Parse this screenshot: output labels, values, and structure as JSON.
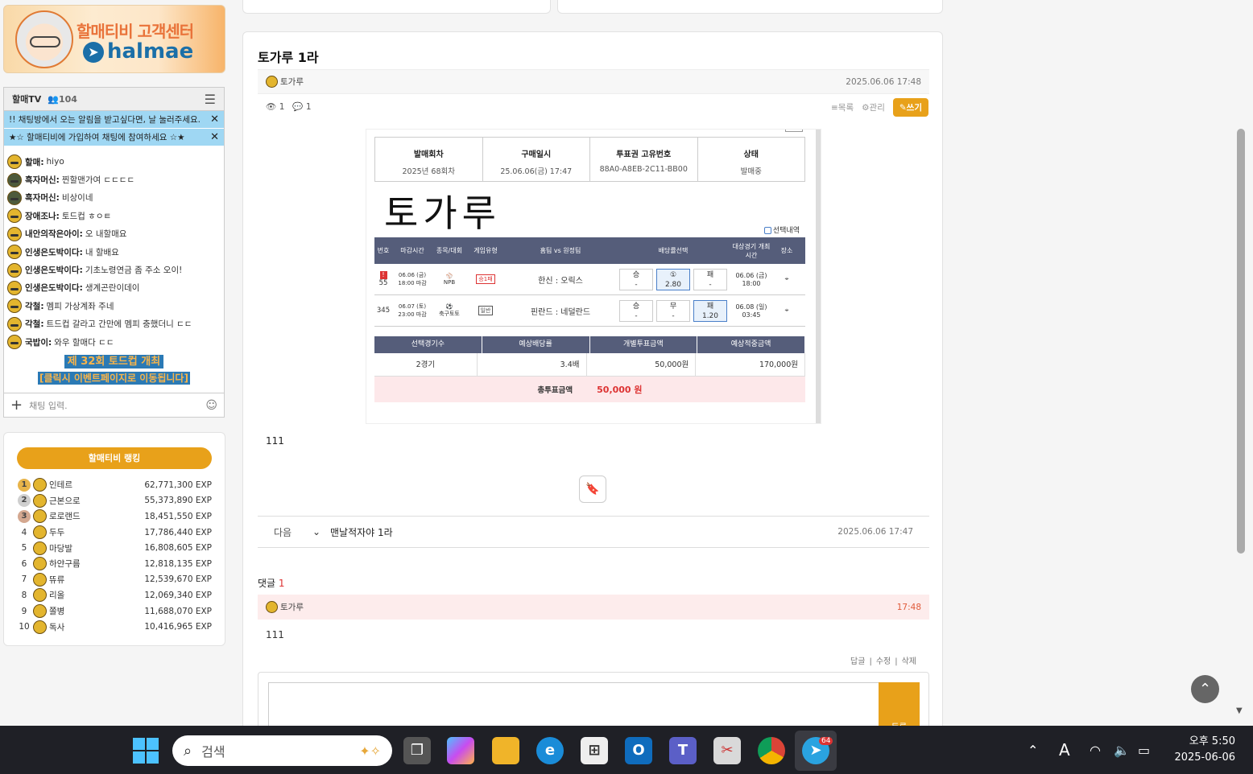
{
  "banner": {
    "title": "할매티비 고객센터",
    "brand": "halmae"
  },
  "chat": {
    "title": "할매TV",
    "count": "104",
    "notices": [
      "!! 채팅방에서 오는 알림을 받고싶다면, 날 눌러주세요.",
      "★☆ 할매티비에 가입하여 채팅에 참여하세요 ☆★"
    ],
    "messages": [
      {
        "nick": "할매:",
        "text": "hiyo"
      },
      {
        "nick": "흑자머신:",
        "text": "찐할맨가여 ㄷㄷㄷㄷ"
      },
      {
        "nick": "흑자머신:",
        "text": "비상이네"
      },
      {
        "nick": "장애조나:",
        "text": "토드컵 ㅎㅇㅌ"
      },
      {
        "nick": "내안의작은아이:",
        "text": "오 내할매요"
      },
      {
        "nick": "인생은도박이다:",
        "text": "내 할배요"
      },
      {
        "nick": "인생은도박이다:",
        "text": "기초노령연금 좀 주소 오이!"
      },
      {
        "nick": "인생은도박이다:",
        "text": "생계곤란이데이"
      },
      {
        "nick": "각철:",
        "text": "멤피 가상계좌 주네"
      },
      {
        "nick": "각철:",
        "text": "트드컵 갈라고 간만에 멤피 충했더니 ㄷㄷ"
      },
      {
        "nick": "국밥이:",
        "text": "와우 할매다 ㄷㄷ"
      }
    ],
    "event_line1": "제 32회 토드컵 개최",
    "event_line2": "[클릭시 이벤트페이지로 이동됩니다]",
    "input_placeholder": "채팅 입력."
  },
  "ranking": {
    "title": "할매티비 랭킹",
    "rows": [
      {
        "rank": "1",
        "name": "인테르",
        "exp": "62,771,300 EXP"
      },
      {
        "rank": "2",
        "name": "근본으로",
        "exp": "55,373,890 EXP"
      },
      {
        "rank": "3",
        "name": "로로랜드",
        "exp": "18,451,550 EXP"
      },
      {
        "rank": "4",
        "name": "두두",
        "exp": "17,786,440 EXP"
      },
      {
        "rank": "5",
        "name": "마당발",
        "exp": "16,808,605 EXP"
      },
      {
        "rank": "6",
        "name": "하얀구름",
        "exp": "12,818,135 EXP"
      },
      {
        "rank": "7",
        "name": "뜌류",
        "exp": "12,539,670 EXP"
      },
      {
        "rank": "8",
        "name": "리올",
        "exp": "12,069,340 EXP"
      },
      {
        "rank": "9",
        "name": "쫄병",
        "exp": "11,688,070 EXP"
      },
      {
        "rank": "10",
        "name": "독사",
        "exp": "10,416,965 EXP"
      }
    ]
  },
  "article": {
    "title": "토가루 1라",
    "author": "토가루",
    "date": "2025.06.06 17:48",
    "views": "1",
    "comments": "1",
    "list_label": "목록",
    "manage_label": "관리",
    "write_label": "쓰기",
    "body": "111"
  },
  "ticket": {
    "head": [
      {
        "k": "발매회차",
        "v": "2025년 68회차"
      },
      {
        "k": "구매일시",
        "v": "25.06.06(금) 17:47"
      },
      {
        "k": "투표권 고유번호",
        "v": "88A0-A8EB-2C11-BB00"
      },
      {
        "k": "상태",
        "v": "발매중"
      }
    ],
    "handwriting": "토가루",
    "select_history": "선택내역",
    "columns": [
      "번호",
      "마감시간",
      "종목/대회",
      "게임유형",
      "홈팀 vs 원정팀",
      "배당률선택",
      "대상경기 개최시간",
      "장소"
    ],
    "rows": [
      {
        "no": "55",
        "deadline": "06.06 (금) 18:00 마감",
        "sport": "NPB",
        "type": "승1패",
        "match": "한신 : 오릭스",
        "odds": [
          {
            "l": "승",
            "v": "-"
          },
          {
            "l": "①",
            "v": "2.80"
          },
          {
            "l": "패",
            "v": "-"
          }
        ],
        "game_time": "06.06 (금) 18:00"
      },
      {
        "no": "345",
        "deadline": "06.07 (토) 23:00 마감",
        "sport": "축구토토",
        "type": "일반",
        "match": "핀란드 : 네덜란드",
        "odds": [
          {
            "l": "승",
            "v": "-"
          },
          {
            "l": "무",
            "v": "-"
          },
          {
            "l": "패",
            "v": "1.20"
          }
        ],
        "game_time": "06.08 (일) 03:45"
      }
    ],
    "summary_head": [
      "선택경기수",
      "예상배당률",
      "개별투표금액",
      "예상적중금액"
    ],
    "summary_vals": [
      "2경기",
      "3.4배",
      "50,000원",
      "170,000원"
    ],
    "total_label": "총투표금액",
    "total_value": "50,000 원"
  },
  "nav": {
    "label": "다음",
    "title": "맨날적자야 1라",
    "date": "2025.06.06 17:47"
  },
  "comments": {
    "label": "댓글",
    "count": "1",
    "items": [
      {
        "author": "토가루",
        "time": "17:48",
        "text": "111"
      }
    ],
    "actions": [
      "답글",
      "수정",
      "삭제"
    ],
    "submit_label": "등록"
  },
  "taskbar": {
    "search_placeholder": "검색",
    "badge": "64",
    "time": "오후 5:50",
    "date": "2025-06-06"
  }
}
